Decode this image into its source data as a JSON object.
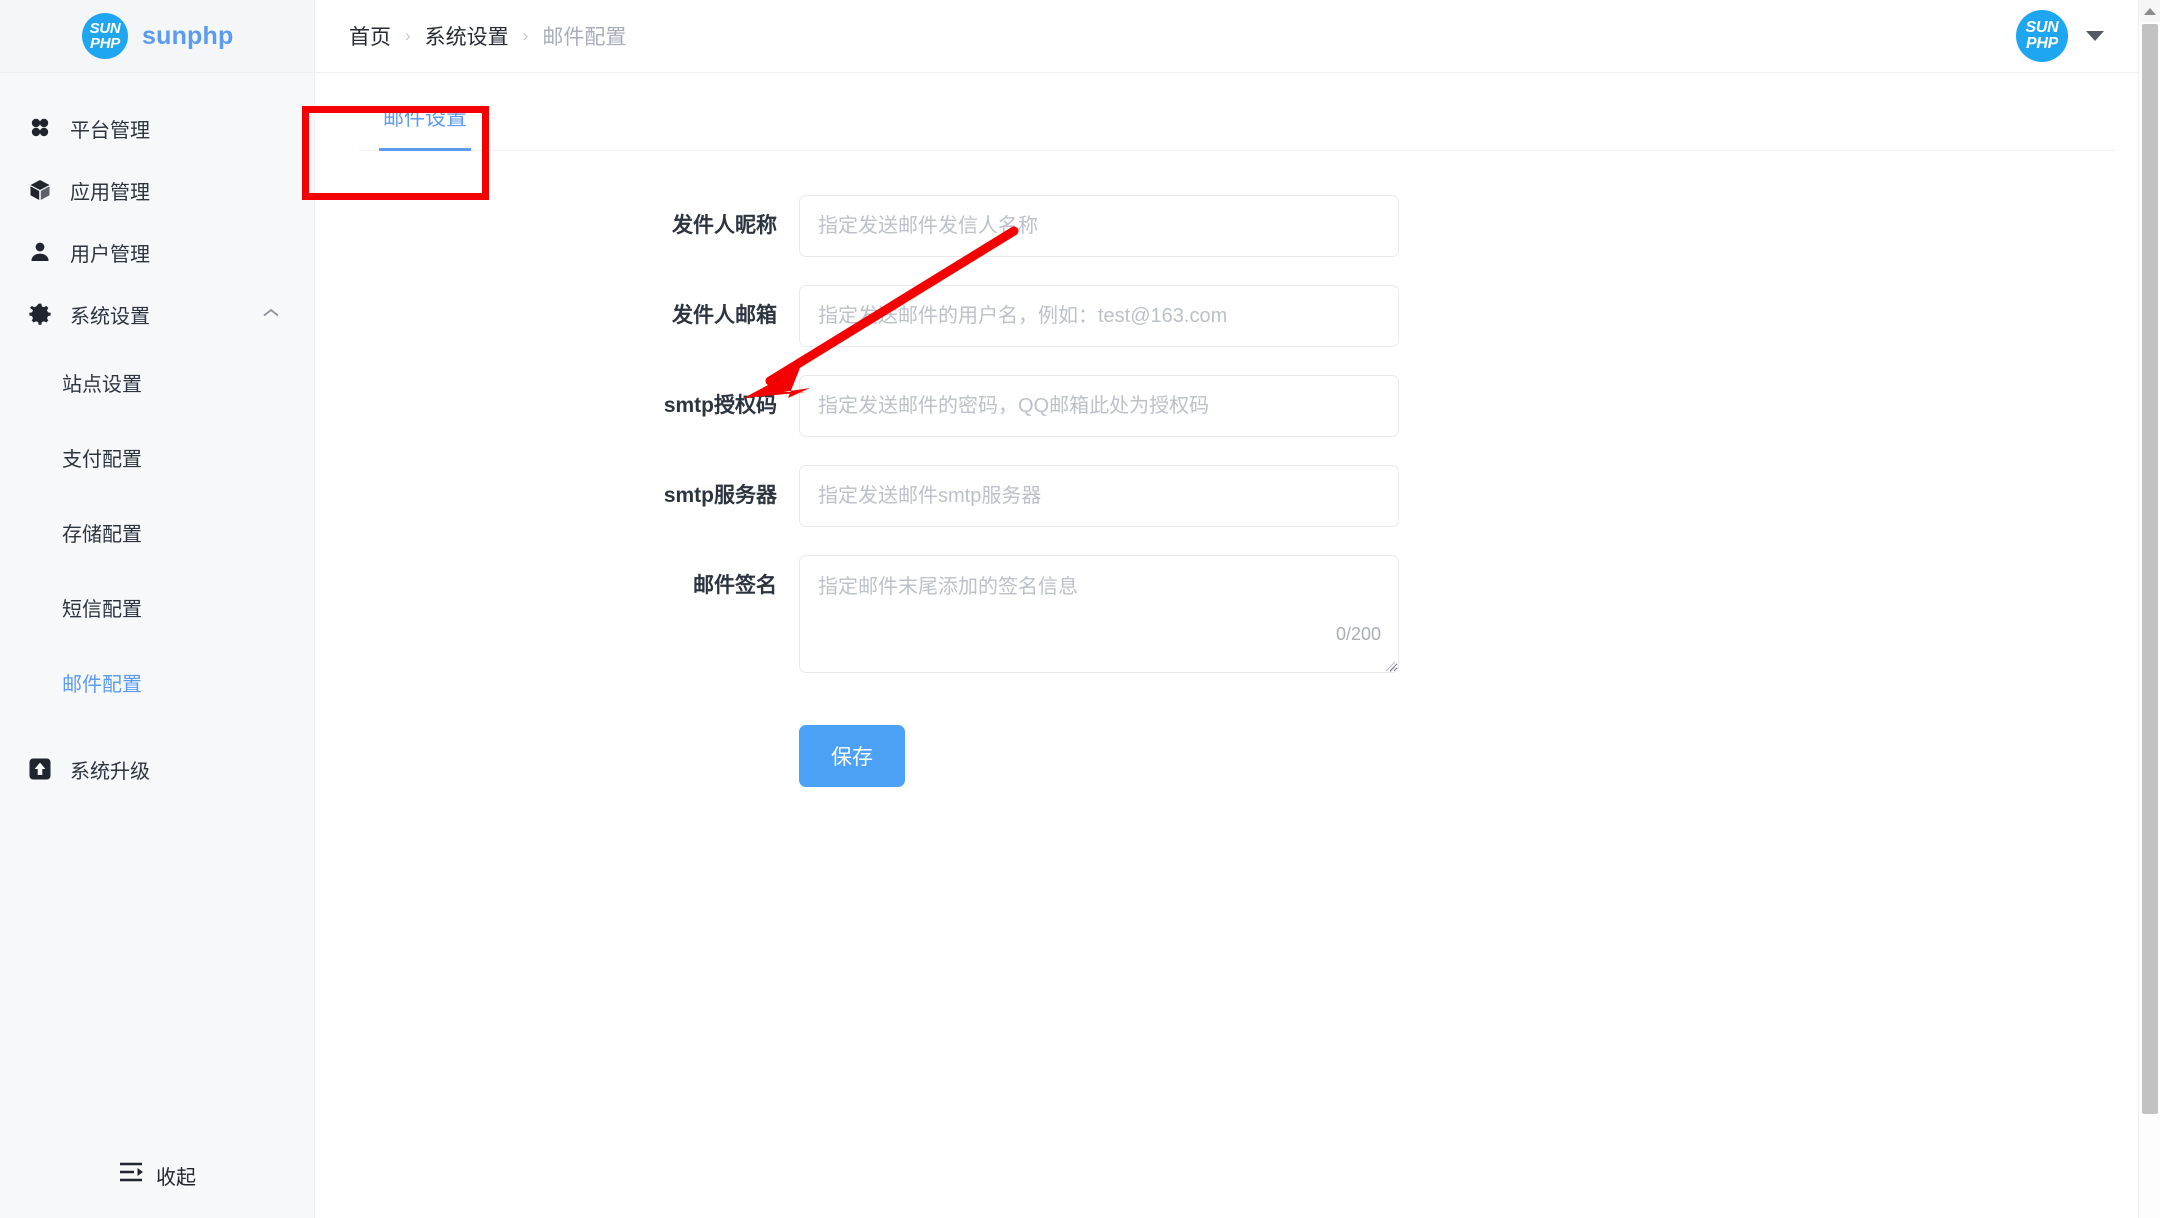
{
  "brand": {
    "logo_line1": "SUN",
    "logo_line2": "PHP",
    "name": "sunphp"
  },
  "sidebar": {
    "items": [
      {
        "label": "平台管理",
        "icon": "grid-icon",
        "active": false
      },
      {
        "label": "应用管理",
        "icon": "cube-icon",
        "active": false
      },
      {
        "label": "用户管理",
        "icon": "user-icon",
        "active": false
      },
      {
        "label": "系统设置",
        "icon": "gear-icon",
        "active": false,
        "expanded": true
      }
    ],
    "sub_items": [
      {
        "label": "站点设置",
        "active": false
      },
      {
        "label": "支付配置",
        "active": false
      },
      {
        "label": "存储配置",
        "active": false
      },
      {
        "label": "短信配置",
        "active": false
      },
      {
        "label": "邮件配置",
        "active": true
      }
    ],
    "upgrade": {
      "label": "系统升级",
      "icon": "upload-box-icon"
    },
    "collapse": {
      "label": "收起",
      "icon": "menu-fold-icon"
    }
  },
  "topbar": {
    "breadcrumb": [
      {
        "label": "首页",
        "current": false
      },
      {
        "label": "系统设置",
        "current": false
      },
      {
        "label": "邮件配置",
        "current": true
      }
    ],
    "separator": "›",
    "avatar_line1": "SUN",
    "avatar_line2": "PHP"
  },
  "tabs": [
    {
      "label": "邮件设置",
      "active": true
    }
  ],
  "form": {
    "fields": [
      {
        "label": "发件人昵称",
        "value": "",
        "placeholder": "指定发送邮件发信人名称",
        "type": "text"
      },
      {
        "label": "发件人邮箱",
        "value": "",
        "placeholder": "指定发送邮件的用户名，例如：test@163.com",
        "type": "text"
      },
      {
        "label": "smtp授权码",
        "value": "",
        "placeholder": "指定发送邮件的密码，QQ邮箱此处为授权码",
        "type": "text"
      },
      {
        "label": "smtp服务器",
        "value": "",
        "placeholder": "指定发送邮件smtp服务器",
        "type": "text"
      },
      {
        "label": "邮件签名",
        "value": "",
        "placeholder": "指定邮件末尾添加的签名信息",
        "type": "textarea",
        "counter": "0/200"
      }
    ],
    "save_label": "保存"
  },
  "colors": {
    "accent_blue": "#5b9bf0",
    "button_blue": "#4ba1f5",
    "logo_blue": "#1ea7f0",
    "annotation_red": "#f40000",
    "sidebar_bg": "#f7f8fa"
  }
}
